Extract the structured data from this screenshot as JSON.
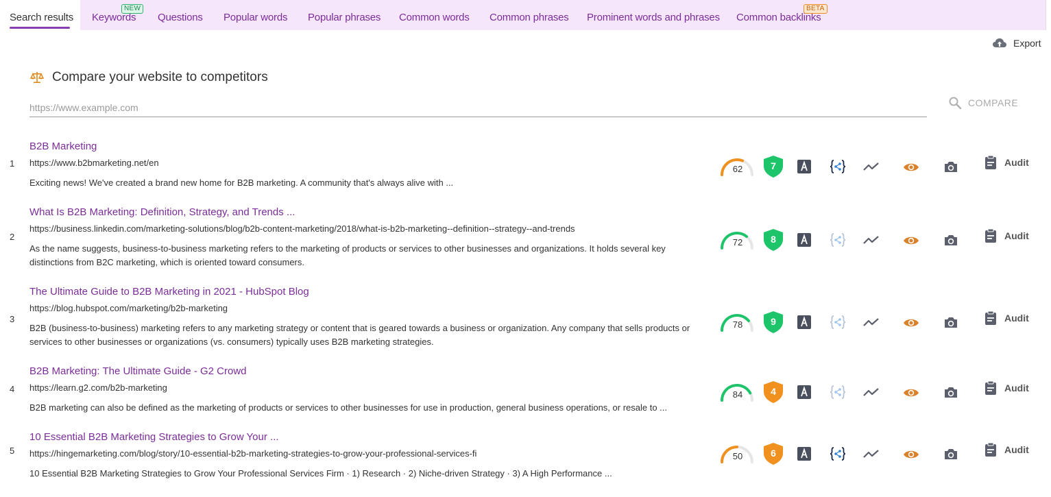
{
  "tabs": [
    {
      "label": "Search results",
      "active": true
    },
    {
      "label": "Keywords",
      "badge": "NEW"
    },
    {
      "label": "Questions"
    },
    {
      "label": "Popular words"
    },
    {
      "label": "Popular phrases"
    },
    {
      "label": "Common words"
    },
    {
      "label": "Common phrases"
    },
    {
      "label": "Prominent words and phrases"
    },
    {
      "label": "Common backlinks",
      "badge": "BETA"
    }
  ],
  "export": {
    "label": "Export",
    "icon": "cloud-upload-icon"
  },
  "compare": {
    "title": "Compare your website to competitors",
    "icon": "scale-icon",
    "placeholder": "https://www.example.com",
    "value": "",
    "button_label": "COMPARE"
  },
  "results": [
    {
      "rank": "1",
      "title": "B2B Marketing",
      "url": "https://www.b2bmarketing.net/en",
      "description": "Exciting news! We've created a brand new home for B2B marketing. A community that's always alive with ...",
      "score": 62,
      "score_color": "#f0901e",
      "shield": 7,
      "shield_color": "#1ec46a",
      "schema_active": true,
      "audit_label": "Audit"
    },
    {
      "rank": "2",
      "title": "What Is B2B Marketing: Definition, Strategy, and Trends ...",
      "url": "https://business.linkedin.com/marketing-solutions/blog/b2b-content-marketing/2018/what-is-b2b-marketing--definition--strategy--and-trends",
      "description": "As the name suggests, business-to-business marketing refers to the marketing of products or services to other businesses and organizations. It holds several key distinctions from B2C marketing, which is oriented toward consumers.",
      "score": 72,
      "score_color": "#1ec46a",
      "shield": 8,
      "shield_color": "#1ec46a",
      "schema_active": false,
      "audit_label": "Audit"
    },
    {
      "rank": "3",
      "title": "The Ultimate Guide to B2B Marketing in 2021 - HubSpot Blog",
      "url": "https://blog.hubspot.com/marketing/b2b-marketing",
      "description": "B2B (business-to-business) marketing refers to any marketing strategy or content that is geared towards a business or organization. Any company that sells products or services to other businesses or organizations (vs. consumers) typically uses B2B marketing strategies.",
      "score": 78,
      "score_color": "#1ec46a",
      "shield": 9,
      "shield_color": "#1ec46a",
      "schema_active": false,
      "audit_label": "Audit"
    },
    {
      "rank": "4",
      "title": "B2B Marketing: The Ultimate Guide - G2 Crowd",
      "url": "https://learn.g2.com/b2b-marketing",
      "description": "B2B marketing can also be defined as the marketing of products or services to other businesses for use in production, general business operations, or resale to ...",
      "score": 84,
      "score_color": "#1ec46a",
      "shield": 4,
      "shield_color": "#f0901e",
      "schema_active": false,
      "audit_label": "Audit"
    },
    {
      "rank": "5",
      "title": "10 Essential B2B Marketing Strategies to Grow Your ...",
      "url": "https://hingemarketing.com/blog/story/10-essential-b2b-marketing-strategies-to-grow-your-professional-services-fi",
      "description": "10 Essential B2B Marketing Strategies to Grow Your Professional Services Firm · 1) Research · 2) Niche-driven Strategy · 3) A High Performance ...",
      "score": 50,
      "score_color": "#f0901e",
      "shield": 6,
      "shield_color": "#f0901e",
      "schema_active": true,
      "audit_label": "Audit"
    }
  ],
  "colors": {
    "accent": "#7b2d9a",
    "tabbar_bg": "#f5e6fb",
    "eye": "#d9822b",
    "icon_gray": "#5a5f6b"
  }
}
